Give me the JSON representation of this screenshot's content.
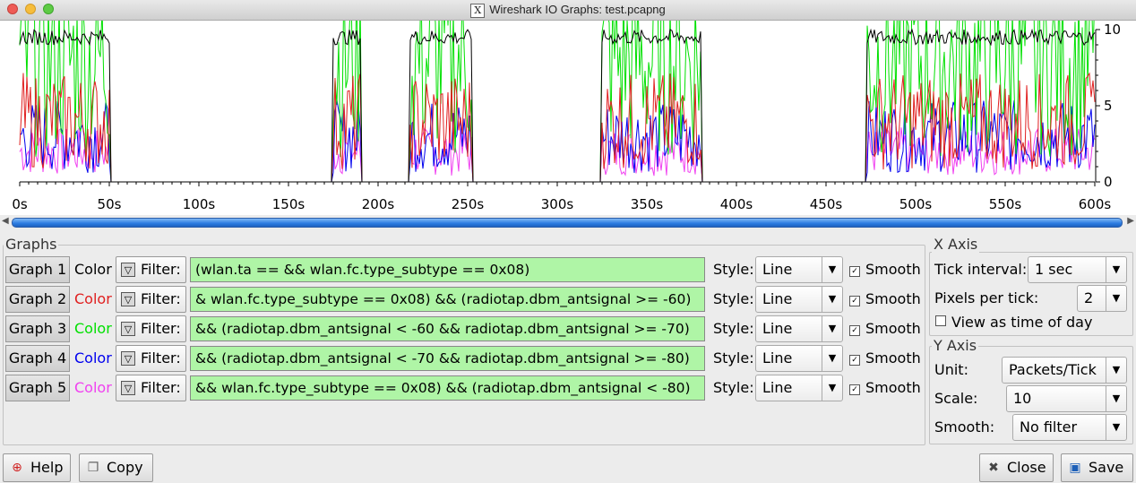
{
  "window": {
    "title": "Wireshark IO Graphs: test.pcapng"
  },
  "chart_data": {
    "type": "line",
    "xlabel": "",
    "ylabel": "",
    "xlim": [
      0,
      600
    ],
    "ylim": [
      0,
      10
    ],
    "x_ticks": [
      "0s",
      "50s",
      "100s",
      "150s",
      "200s",
      "250s",
      "300s",
      "350s",
      "400s",
      "450s",
      "500s",
      "550s",
      "600s"
    ],
    "y_ticks": [
      "10",
      "5",
      "0"
    ],
    "bursts": [
      [
        0,
        50
      ],
      [
        175,
        190
      ],
      [
        218,
        252
      ],
      [
        325,
        380
      ],
      [
        473,
        600
      ]
    ],
    "series": [
      {
        "name": "Graph 1",
        "color": "#000000",
        "level": 10
      },
      {
        "name": "Graph 2",
        "color": "#e02020",
        "level": 4
      },
      {
        "name": "Graph 3",
        "color": "#00e000",
        "level": 8
      },
      {
        "name": "Graph 4",
        "color": "#0000ee",
        "level": 3
      },
      {
        "name": "Graph 5",
        "color": "#f040f0",
        "level": 2
      }
    ]
  },
  "graphs_panel": {
    "title": "Graphs",
    "color_label": "Color",
    "filter_label": "Filter:",
    "style_label": "Style:",
    "smooth_label": "Smooth",
    "rows": [
      {
        "name": "Graph 1",
        "color": "#000000",
        "filter": "(wlan.ta ==                   && wlan.fc.type_subtype == 0x08)",
        "style": "Line",
        "smooth": true
      },
      {
        "name": "Graph 2",
        "color": "#e02020",
        "filter": "& wlan.fc.type_subtype == 0x08) && (radiotap.dbm_antsignal >= -60)",
        "style": "Line",
        "smooth": true
      },
      {
        "name": "Graph 3",
        "color": "#00e000",
        "filter": "&& (radiotap.dbm_antsignal < -60 && radiotap.dbm_antsignal >= -70)",
        "style": "Line",
        "smooth": true
      },
      {
        "name": "Graph 4",
        "color": "#0000ee",
        "filter": "&& (radiotap.dbm_antsignal < -70 && radiotap.dbm_antsignal >= -80)",
        "style": "Line",
        "smooth": true
      },
      {
        "name": "Graph 5",
        "color": "#f040f0",
        "filter": " && wlan.fc.type_subtype == 0x08) && (radiotap.dbm_antsignal < -80)",
        "style": "Line",
        "smooth": true
      }
    ]
  },
  "x_axis": {
    "title": "X Axis",
    "tick_interval_label": "Tick interval:",
    "tick_interval": "1 sec",
    "pixels_per_tick_label": "Pixels per tick:",
    "pixels_per_tick": "2",
    "view_time_of_day": "View as time of day"
  },
  "y_axis": {
    "title": "Y Axis",
    "unit_label": "Unit:",
    "unit": "Packets/Tick",
    "scale_label": "Scale:",
    "scale": "10",
    "smooth_label": "Smooth:",
    "smooth": "No filter"
  },
  "buttons": {
    "help": "Help",
    "copy": "Copy",
    "close": "Close",
    "save": "Save"
  }
}
